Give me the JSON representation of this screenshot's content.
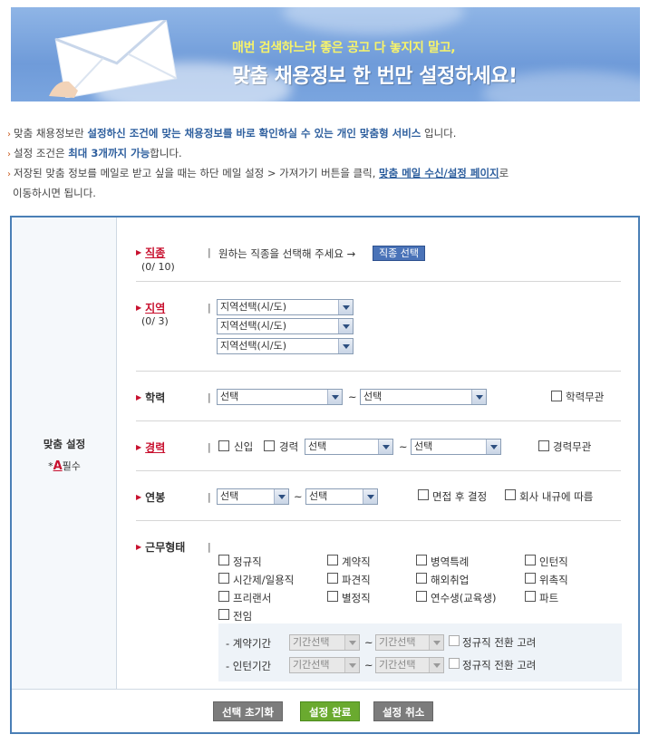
{
  "banner": {
    "line1": "매번 검색하느라 좋은 공고 다 놓지지 말고,",
    "line2": "맞춤 채용정보 한 번만 설정하세요!"
  },
  "intro": {
    "l1_a": "맞춤 채용정보란 ",
    "l1_b": "설정하신 조건에 맞는 채용정보를 바로 확인하실 수 있는 개인 맞춤형 서비스",
    "l1_c": " 입니다.",
    "l2_a": "설정 조건은 ",
    "l2_b": "최대 3개까지 가능",
    "l2_c": "합니다.",
    "l3_a": "저장된 맞춤 정보를 메일로 받고 싶을 때는 하단 메일 설정 > 가져가기 버튼을 클릭, ",
    "l3_b": "맞춤 메일 수신/설정 페이지",
    "l3_c": "로",
    "l4": "이동하시면 됩니다."
  },
  "left": {
    "title": "맞춤 설정",
    "req_mark": "A",
    "req_text": "필수"
  },
  "job": {
    "label": "직종",
    "count": "(0/ 10)",
    "desc": "원하는 직종을 선택해 주세요 →",
    "btn": "직종 선택"
  },
  "region": {
    "label": "지역",
    "count": "(0/ 3)",
    "options": [
      "지역선택(시/도)",
      "지역선택(시/도)",
      "지역선택(시/도)"
    ]
  },
  "edu": {
    "label": "학력",
    "from": "선택",
    "tilde": "~",
    "to": "선택",
    "none": "학력무관"
  },
  "career": {
    "label": "경력",
    "new": "신입",
    "exp": "경력",
    "from": "선택",
    "tilde": "~",
    "to": "선택",
    "none": "경력무관"
  },
  "salary": {
    "label": "연봉",
    "from": "선택",
    "tilde": "~",
    "to": "선택",
    "opt1": "면접 후 결정",
    "opt2": "회사 내규에 따름"
  },
  "work": {
    "label": "근무형태",
    "types": [
      "정규직",
      "계약직",
      "병역특례",
      "인턴직",
      "시간제/일용직",
      "파견직",
      "해외취업",
      "위촉직",
      "프리랜서",
      "별정직",
      "연수생(교육생)",
      "파트",
      "전임"
    ],
    "contract_label": "- 계약기간",
    "intern_label": "- 인턴기간",
    "period_select": "기간선택",
    "tilde": "~",
    "convert": "정규직 전환 고려"
  },
  "buttons": {
    "reset": "선택 초기화",
    "done": "설정 완료",
    "cancel": "설정 취소"
  },
  "colors": {
    "accent_blue": "#4a7fb6",
    "required_red": "#c8102e",
    "done_green": "#6aaa2f"
  }
}
